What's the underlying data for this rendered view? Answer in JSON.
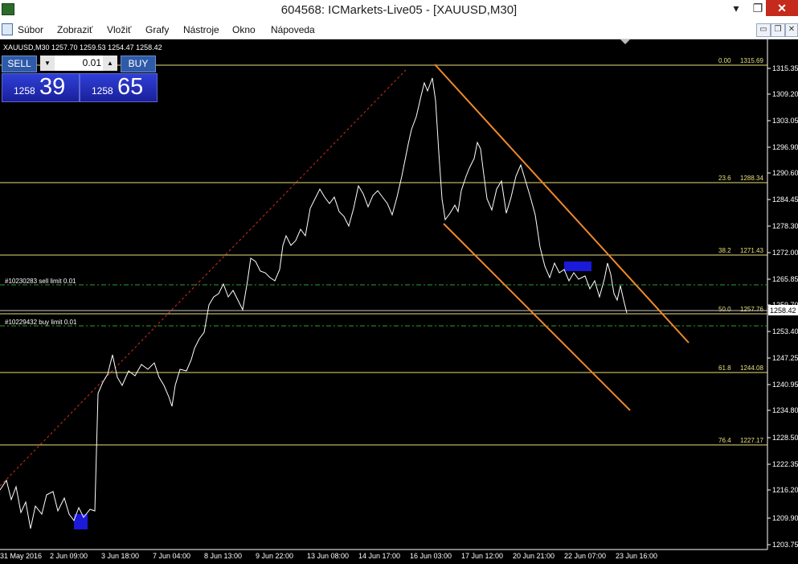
{
  "window": {
    "title": "604568: ICMarkets-Live05 - [XAUUSD,M30]",
    "min": "▾",
    "max": "❐",
    "close": "✕"
  },
  "menu": [
    "Súbor",
    "Zobraziť",
    "Vložiť",
    "Grafy",
    "Nástroje",
    "Okno",
    "Nápoveda"
  ],
  "mdi": {
    "min": "▭",
    "restore": "❐",
    "close": "✕"
  },
  "chart": {
    "symbol_info": "XAUUSD,M30  1257.70 1259.53 1254.47 1258.42",
    "current_price": "1258.42",
    "price_axis": [
      "1315.35",
      "1309.20",
      "1303.05",
      "1296.90",
      "1290.60",
      "1284.45",
      "1278.30",
      "1272.00",
      "1265.85",
      "1259.70",
      "1253.40",
      "1247.25",
      "1240.95",
      "1234.80",
      "1228.50",
      "1222.35",
      "1216.20",
      "1209.90",
      "1203.75"
    ],
    "time_axis": [
      "31 May 2016",
      "2 Jun 09:00",
      "3 Jun 18:00",
      "7 Jun 04:00",
      "8 Jun 13:00",
      "9 Jun 22:00",
      "13 Jun 08:00",
      "14 Jun 17:00",
      "16 Jun 03:00",
      "17 Jun 12:00",
      "20 Jun 21:00",
      "22 Jun 07:00",
      "23 Jun 16:00"
    ],
    "fib_levels": [
      {
        "ratio": "0.00",
        "price": "1315.69"
      },
      {
        "ratio": "23.6",
        "price": "1288.34"
      },
      {
        "ratio": "38.2",
        "price": "1271.43"
      },
      {
        "ratio": "50.0",
        "price": "1257.76"
      },
      {
        "ratio": "61.8",
        "price": "1244.08"
      },
      {
        "ratio": "76.4",
        "price": "1227.17"
      }
    ],
    "orders": [
      {
        "label": "#10230283 sell limit 0.01"
      },
      {
        "label": "#10229432 buy limit 0.01"
      }
    ],
    "colors": {
      "price_line": "#ffffff",
      "fib": "#e8e07a",
      "channel": "#f08a2a",
      "trend": "#d03020",
      "order": "#2e9e2e",
      "highlight": "#1a1ad8"
    }
  },
  "trade": {
    "sell_label": "SELL",
    "buy_label": "BUY",
    "lot": "0.01",
    "lot_dec": "▼",
    "lot_inc": "▲",
    "sell_price_main": "1258",
    "sell_price_big": "39",
    "buy_price_main": "1258",
    "buy_price_big": "65"
  }
}
